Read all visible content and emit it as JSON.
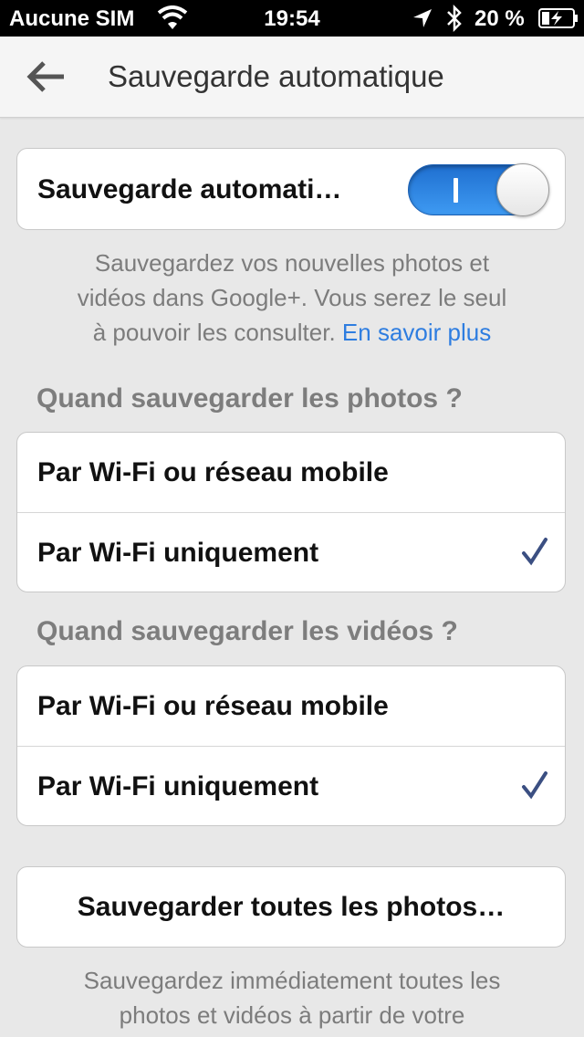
{
  "status_bar": {
    "carrier": "Aucune SIM",
    "time": "19:54",
    "battery": "20 %"
  },
  "nav": {
    "title": "Sauvegarde automatique"
  },
  "auto_backup": {
    "label": "Sauvegarde automati…",
    "enabled": true
  },
  "intro": {
    "line1": "Sauvegardez vos nouvelles photos et",
    "line2": "vidéos dans Google+. Vous serez le seul",
    "line3": "à pouvoir les consulter.",
    "link": "En savoir plus"
  },
  "photos": {
    "title": "Quand sauvegarder les photos ?",
    "options": [
      "Par Wi-Fi ou réseau mobile",
      "Par Wi-Fi uniquement"
    ],
    "selected_index": 1
  },
  "videos": {
    "title": "Quand sauvegarder les vidéos ?",
    "options": [
      "Par Wi-Fi ou réseau mobile",
      "Par Wi-Fi uniquement"
    ],
    "selected_index": 1
  },
  "backup_all": {
    "label": "Sauvegarder toutes les photos…"
  },
  "backup_all_desc": {
    "line1": "Sauvegardez immédiatement toutes les",
    "line2": "photos et vidéos à partir de votre"
  },
  "colors": {
    "accent": "#2e7de0",
    "check": "#3b4f82",
    "background": "#e8e8e8"
  }
}
